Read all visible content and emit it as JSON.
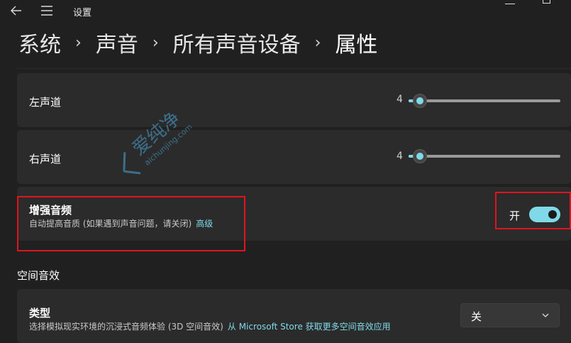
{
  "window": {
    "title": "设置"
  },
  "breadcrumb": {
    "items": [
      "系统",
      "声音",
      "所有声音设备",
      "属性"
    ],
    "separator": "›"
  },
  "balance": {
    "left": {
      "label": "左声道",
      "value": "4",
      "level_percent": 4
    },
    "right": {
      "label": "右声道",
      "value": "4",
      "level_percent": 4
    }
  },
  "enhance_audio": {
    "title": "增强音频",
    "description": "自动提高音质 (如果遇到声音问题，请关闭)",
    "link": "高级",
    "toggle_state_label": "开",
    "toggle_on": true
  },
  "spatial_audio": {
    "heading": "空间音效",
    "type_title": "类型",
    "type_description": "选择模拟现实环境的沉浸式音频体验 (3D 空间音效)",
    "store_link": "从 Microsoft Store 获取更多空间音效应用",
    "selected": "关"
  },
  "watermark": {
    "main": "爱纯净",
    "sub": "aichunjing.com"
  },
  "colors": {
    "accent": "#7fd9e8",
    "background": "#202020",
    "card": "#2b2b2b",
    "highlight_box": "#e0141f"
  },
  "icons": {
    "back": "back-arrow-icon",
    "menu": "hamburger-menu-icon",
    "dropdown": "chevron-down-icon"
  }
}
